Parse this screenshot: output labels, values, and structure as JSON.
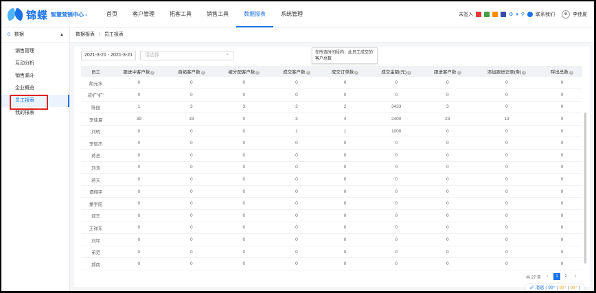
{
  "app": {
    "logo_text": "锦蝶",
    "logo_sub": "智慧营销中心 -"
  },
  "nav": [
    "首页",
    "客户管理",
    "拓客工具",
    "销售工具",
    "数据报表",
    "系统管理"
  ],
  "nav_active_index": 4,
  "topbar": {
    "unsigned": "未签入",
    "contact": "联系我们",
    "user": "李佳夏"
  },
  "sidebar": {
    "section": "数据",
    "items": [
      "销售管理",
      "互动分析",
      "销售漏斗",
      "企业概览",
      "员工报表",
      "我的报表"
    ],
    "active_index": 4
  },
  "breadcrumb": {
    "parent": "数据报表",
    "sep": "/",
    "current": "员工报表"
  },
  "filters": {
    "date_range": "2021-3-21 - 2021-3-21",
    "select_placeholder": "请选择"
  },
  "tooltip": "在所选时间段内，此员工成交的客户总数",
  "table": {
    "columns": [
      "员工",
      "跟进中客户数",
      "自拓客户数",
      "被分配客户数",
      "成交客户数",
      "成交订单数",
      "成交金额(元)",
      "跟进客户数",
      "添加跟进记录(条)",
      "呼出总数"
    ],
    "rows": [
      [
        "胡元水",
        "0",
        "0",
        "0",
        "0",
        "0",
        "0",
        "0",
        "0",
        "0"
      ],
      [
        "叔扩\"扩\"",
        "0",
        "0",
        "0",
        "0",
        "0",
        "0",
        "0",
        "0",
        "0"
      ],
      [
        "陈园",
        "1",
        "3",
        "3",
        "2",
        "2",
        "3433",
        "3",
        "0",
        "0"
      ],
      [
        "李佳夏",
        "39",
        "33",
        "0",
        "3",
        "4",
        "2400",
        "23",
        "13",
        "0"
      ],
      [
        "刘明",
        "0",
        "0",
        "0",
        "1",
        "1",
        "1000",
        "0",
        "0",
        "0"
      ],
      [
        "李智杰",
        "0",
        "0",
        "0",
        "0",
        "0",
        "0",
        "0",
        "0",
        "0"
      ],
      [
        "蒋总",
        "0",
        "0",
        "0",
        "0",
        "0",
        "0",
        "0",
        "0",
        "0"
      ],
      [
        "刘浩",
        "0",
        "0",
        "0",
        "0",
        "0",
        "0",
        "0",
        "0",
        "0"
      ],
      [
        "蒋天",
        "0",
        "0",
        "0",
        "0",
        "0",
        "0",
        "0",
        "0",
        "0"
      ],
      [
        "谭翔宇",
        "0",
        "0",
        "0",
        "0",
        "0",
        "0",
        "0",
        "0",
        "0"
      ],
      [
        "董宇阳",
        "0",
        "0",
        "0",
        "0",
        "0",
        "0",
        "0",
        "0",
        "0"
      ],
      [
        "叔王",
        "0",
        "0",
        "0",
        "0",
        "0",
        "0",
        "0",
        "0",
        "0"
      ],
      [
        "王祥东",
        "0",
        "0",
        "0",
        "0",
        "0",
        "0",
        "0",
        "0",
        "0"
      ],
      [
        "刘坪",
        "0",
        "0",
        "0",
        "0",
        "0",
        "0",
        "0",
        "0",
        "0"
      ],
      [
        "弟范",
        "0",
        "0",
        "0",
        "0",
        "0",
        "0",
        "0",
        "0",
        "0"
      ],
      [
        "郝南",
        "0",
        "0",
        "0",
        "0",
        "0",
        "0",
        "0",
        "0",
        "0"
      ]
    ]
  },
  "pager": {
    "total": "共 27 条",
    "pages": [
      "1",
      "2"
    ],
    "active": "1"
  },
  "msgbar": {
    "label": "消息",
    "a": "99⁺",
    "b": "99⁺",
    "c": "99⁺"
  },
  "colors": {
    "accent": "#1a73e8",
    "highlight_border": "#e02020"
  }
}
